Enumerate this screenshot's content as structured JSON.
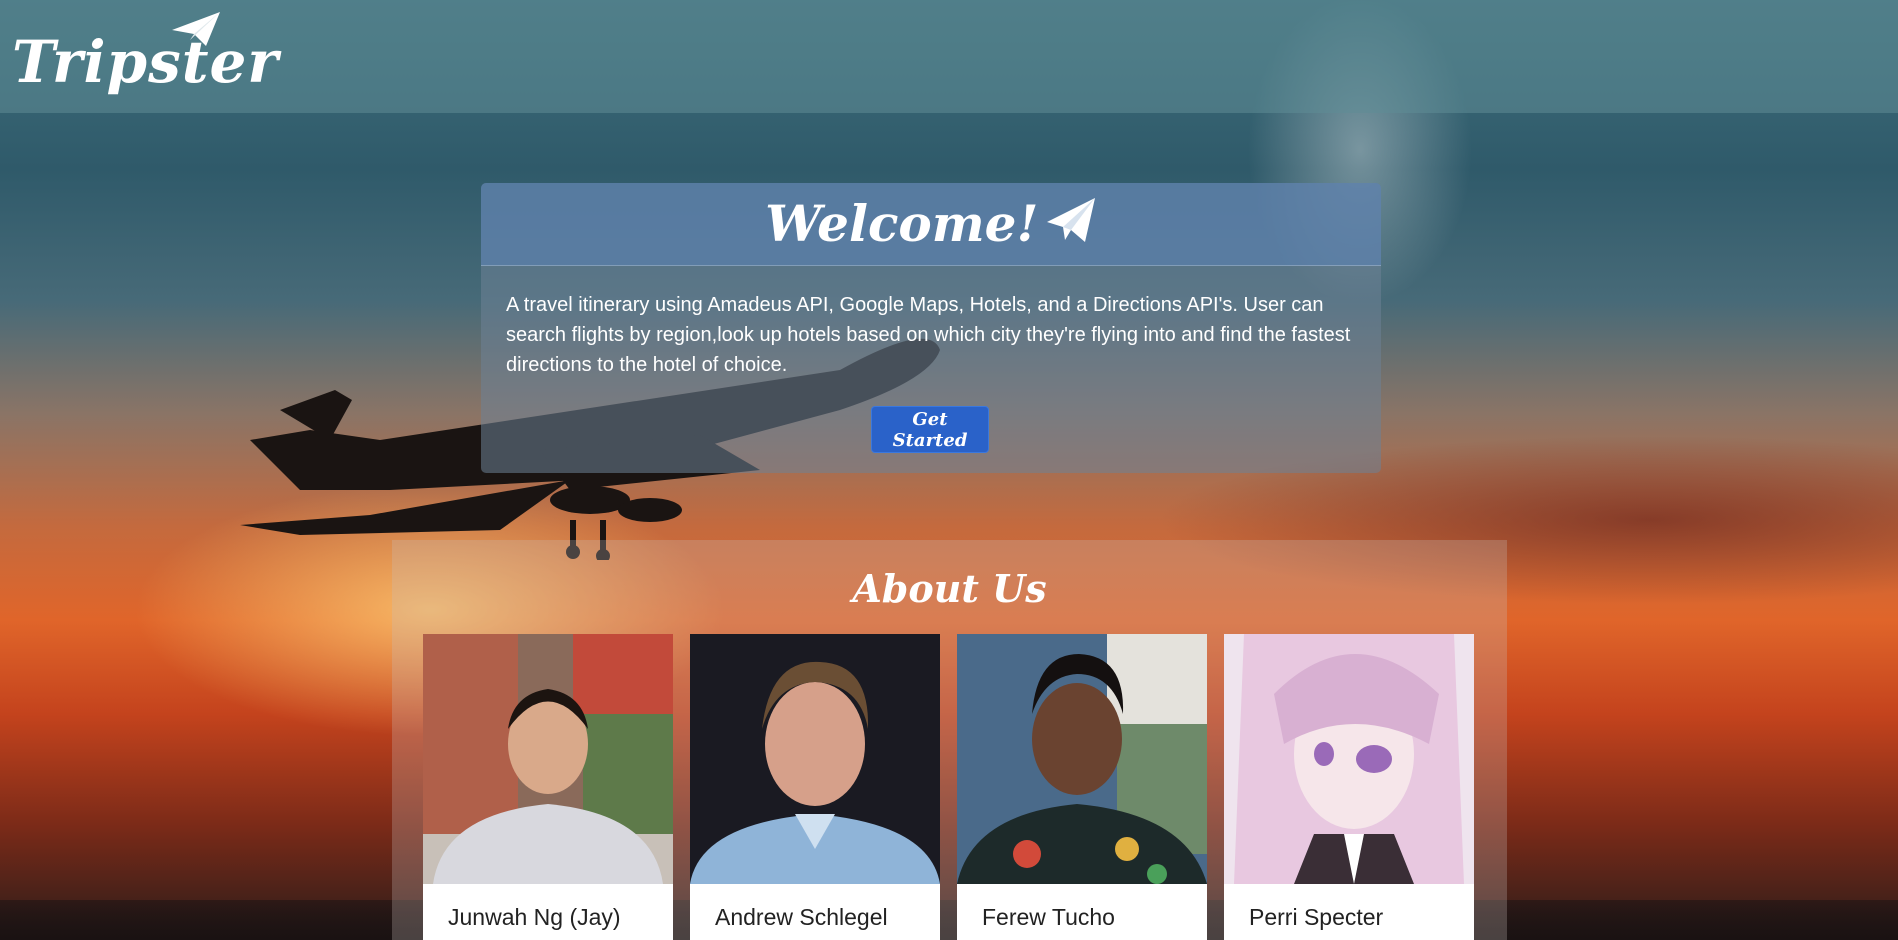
{
  "nav": {
    "brand": "Tripster"
  },
  "welcome": {
    "title": "Welcome!",
    "description": "A travel itinerary using Amadeus API, Google Maps, Hotels, and a Directions API's. User can search flights by region,look up hotels based on which city they're flying into and find the fastest directions to the hotel of choice.",
    "button_label": "Get Started"
  },
  "about": {
    "title": "About Us",
    "members": [
      {
        "name": "Junwah Ng (Jay)"
      },
      {
        "name": "Andrew Schlegel"
      },
      {
        "name": "Ferew Tucho"
      },
      {
        "name": "Perri Specter"
      }
    ]
  },
  "colors": {
    "navbar": "#5f8c96",
    "button": "#2a62c9",
    "card": "#ffffff",
    "text_light": "#ffffff",
    "text_dark": "#222222"
  },
  "icons": [
    "paper-plane-icon",
    "airplane-silhouette"
  ]
}
